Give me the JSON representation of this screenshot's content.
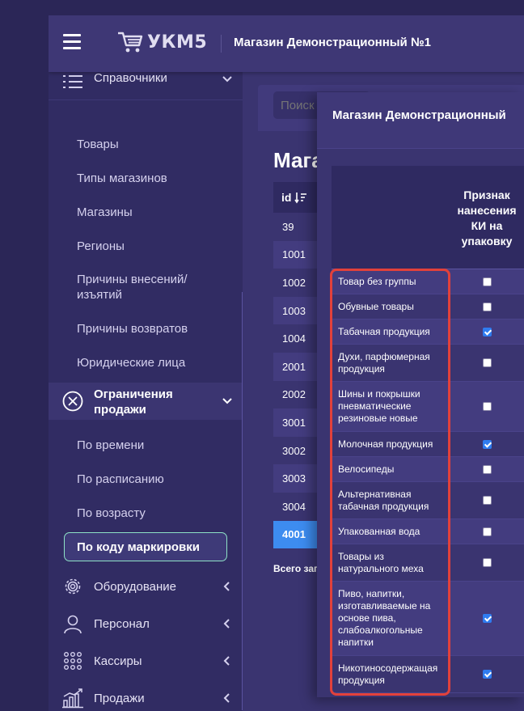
{
  "header": {
    "logo_text": "УКМ5",
    "store": "Магазин Демонстрационный №1"
  },
  "sidebar": {
    "top_partial": "Справочники",
    "dir_items": [
      "Товары",
      "Типы магазинов",
      "Магазины",
      "Регионы",
      "Причины внесений/ изъятий",
      "Причины возвратов",
      "Юридические лица"
    ],
    "restrictions": "Ограничения продажи",
    "restriction_items": [
      "По времени",
      "По расписанию",
      "По возрасту"
    ],
    "active_item": "По коду маркировки",
    "groups": [
      {
        "label": "Оборудование",
        "icon": "gear-icon"
      },
      {
        "label": "Персонал",
        "icon": "user-icon"
      },
      {
        "label": "Кассиры",
        "icon": "keypad-icon"
      },
      {
        "label": "Продажи",
        "icon": "bar-chart-icon"
      }
    ]
  },
  "main": {
    "search_placeholder": "Поиск",
    "title": "Мага",
    "id_header": "id",
    "ids": [
      "39",
      "1001",
      "1002",
      "1003",
      "1004",
      "2001",
      "2002",
      "3001",
      "3002",
      "3003",
      "3004",
      "4001"
    ],
    "total": "Всего зап"
  },
  "modal": {
    "title": "Магазин Демонстрационный",
    "column": "Признак нанесения КИ на упаковку",
    "rows": [
      {
        "name": "Товар без группы",
        "checked": false
      },
      {
        "name": "Обувные товары",
        "checked": false
      },
      {
        "name": "Табачная продукция",
        "checked": true
      },
      {
        "name": "Духи, парфюмерная продукция",
        "checked": false
      },
      {
        "name": "Шины и покрышки пневматические резиновые новые",
        "checked": false
      },
      {
        "name": "Молочная продукция",
        "checked": true
      },
      {
        "name": "Велосипеды",
        "checked": false
      },
      {
        "name": "Альтернативная табачная продукция",
        "checked": false
      },
      {
        "name": "Упакованная вода",
        "checked": false
      },
      {
        "name": "Товары из натурального меха",
        "checked": false
      },
      {
        "name": "Пиво, напитки, изготавливаемые на основе пива, слабоалкогольные напитки",
        "checked": true
      },
      {
        "name": "Никотиносодержащая продукция",
        "checked": true
      }
    ]
  },
  "colors": {
    "accent": "#2f7cf0",
    "highlight": "#e2413b",
    "active_border": "#8ee2c6",
    "selected_row": "#3d8cf0"
  }
}
